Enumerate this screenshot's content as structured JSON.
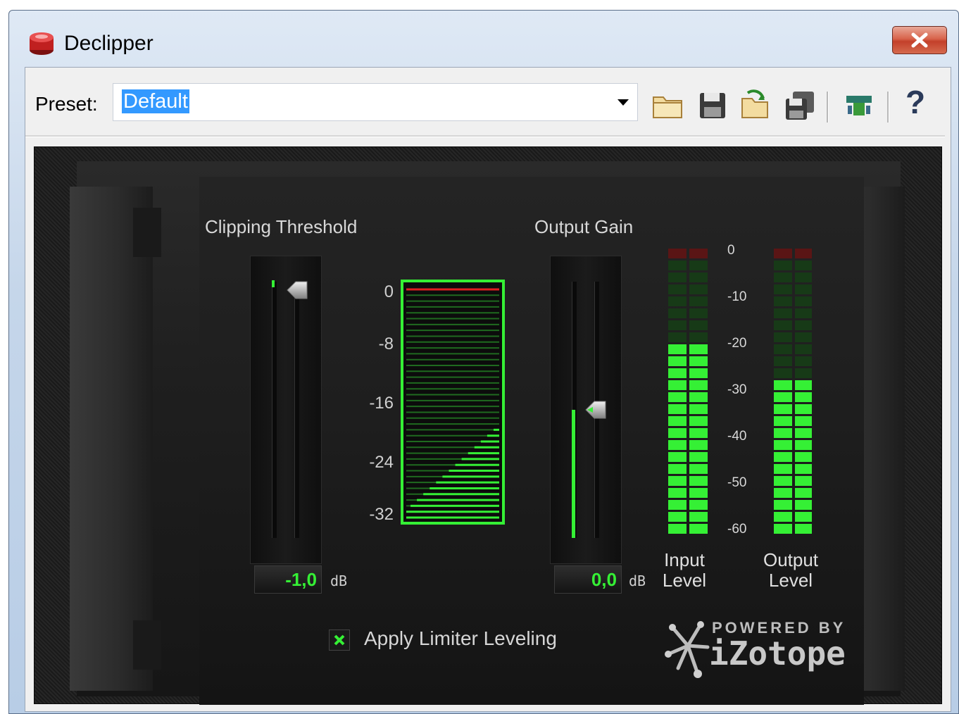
{
  "window": {
    "title": "Declipper"
  },
  "toolbar": {
    "preset_label": "Preset:",
    "preset_value": "Default",
    "icons": [
      "folder-open-icon",
      "save-icon",
      "load-icon",
      "save-as-icon",
      "routing-icon",
      "help-icon"
    ],
    "help_label": "?"
  },
  "clipping": {
    "label": "Clipping Threshold",
    "value": "-1,0",
    "unit": "dB",
    "ticks": [
      "0",
      "-8",
      "-16",
      "-24",
      "-32"
    ]
  },
  "output_gain": {
    "label": "Output Gain",
    "value": "0,0",
    "unit": "dB"
  },
  "meters": {
    "scale": [
      "0",
      "-10",
      "-20",
      "-30",
      "-40",
      "-50",
      "-60"
    ],
    "input_label": "Input\nLevel",
    "output_label": "Output\nLevel",
    "input_level_db": -20,
    "output_level_db": -26
  },
  "limiter": {
    "label": "Apply Limiter Leveling",
    "checked": true
  },
  "branding": {
    "line1": "POWERED BY",
    "line2": "iZotope"
  },
  "colors": {
    "accent_green": "#35f035",
    "panel_dark": "#1e1e1e",
    "clip_red": "#e02020"
  }
}
